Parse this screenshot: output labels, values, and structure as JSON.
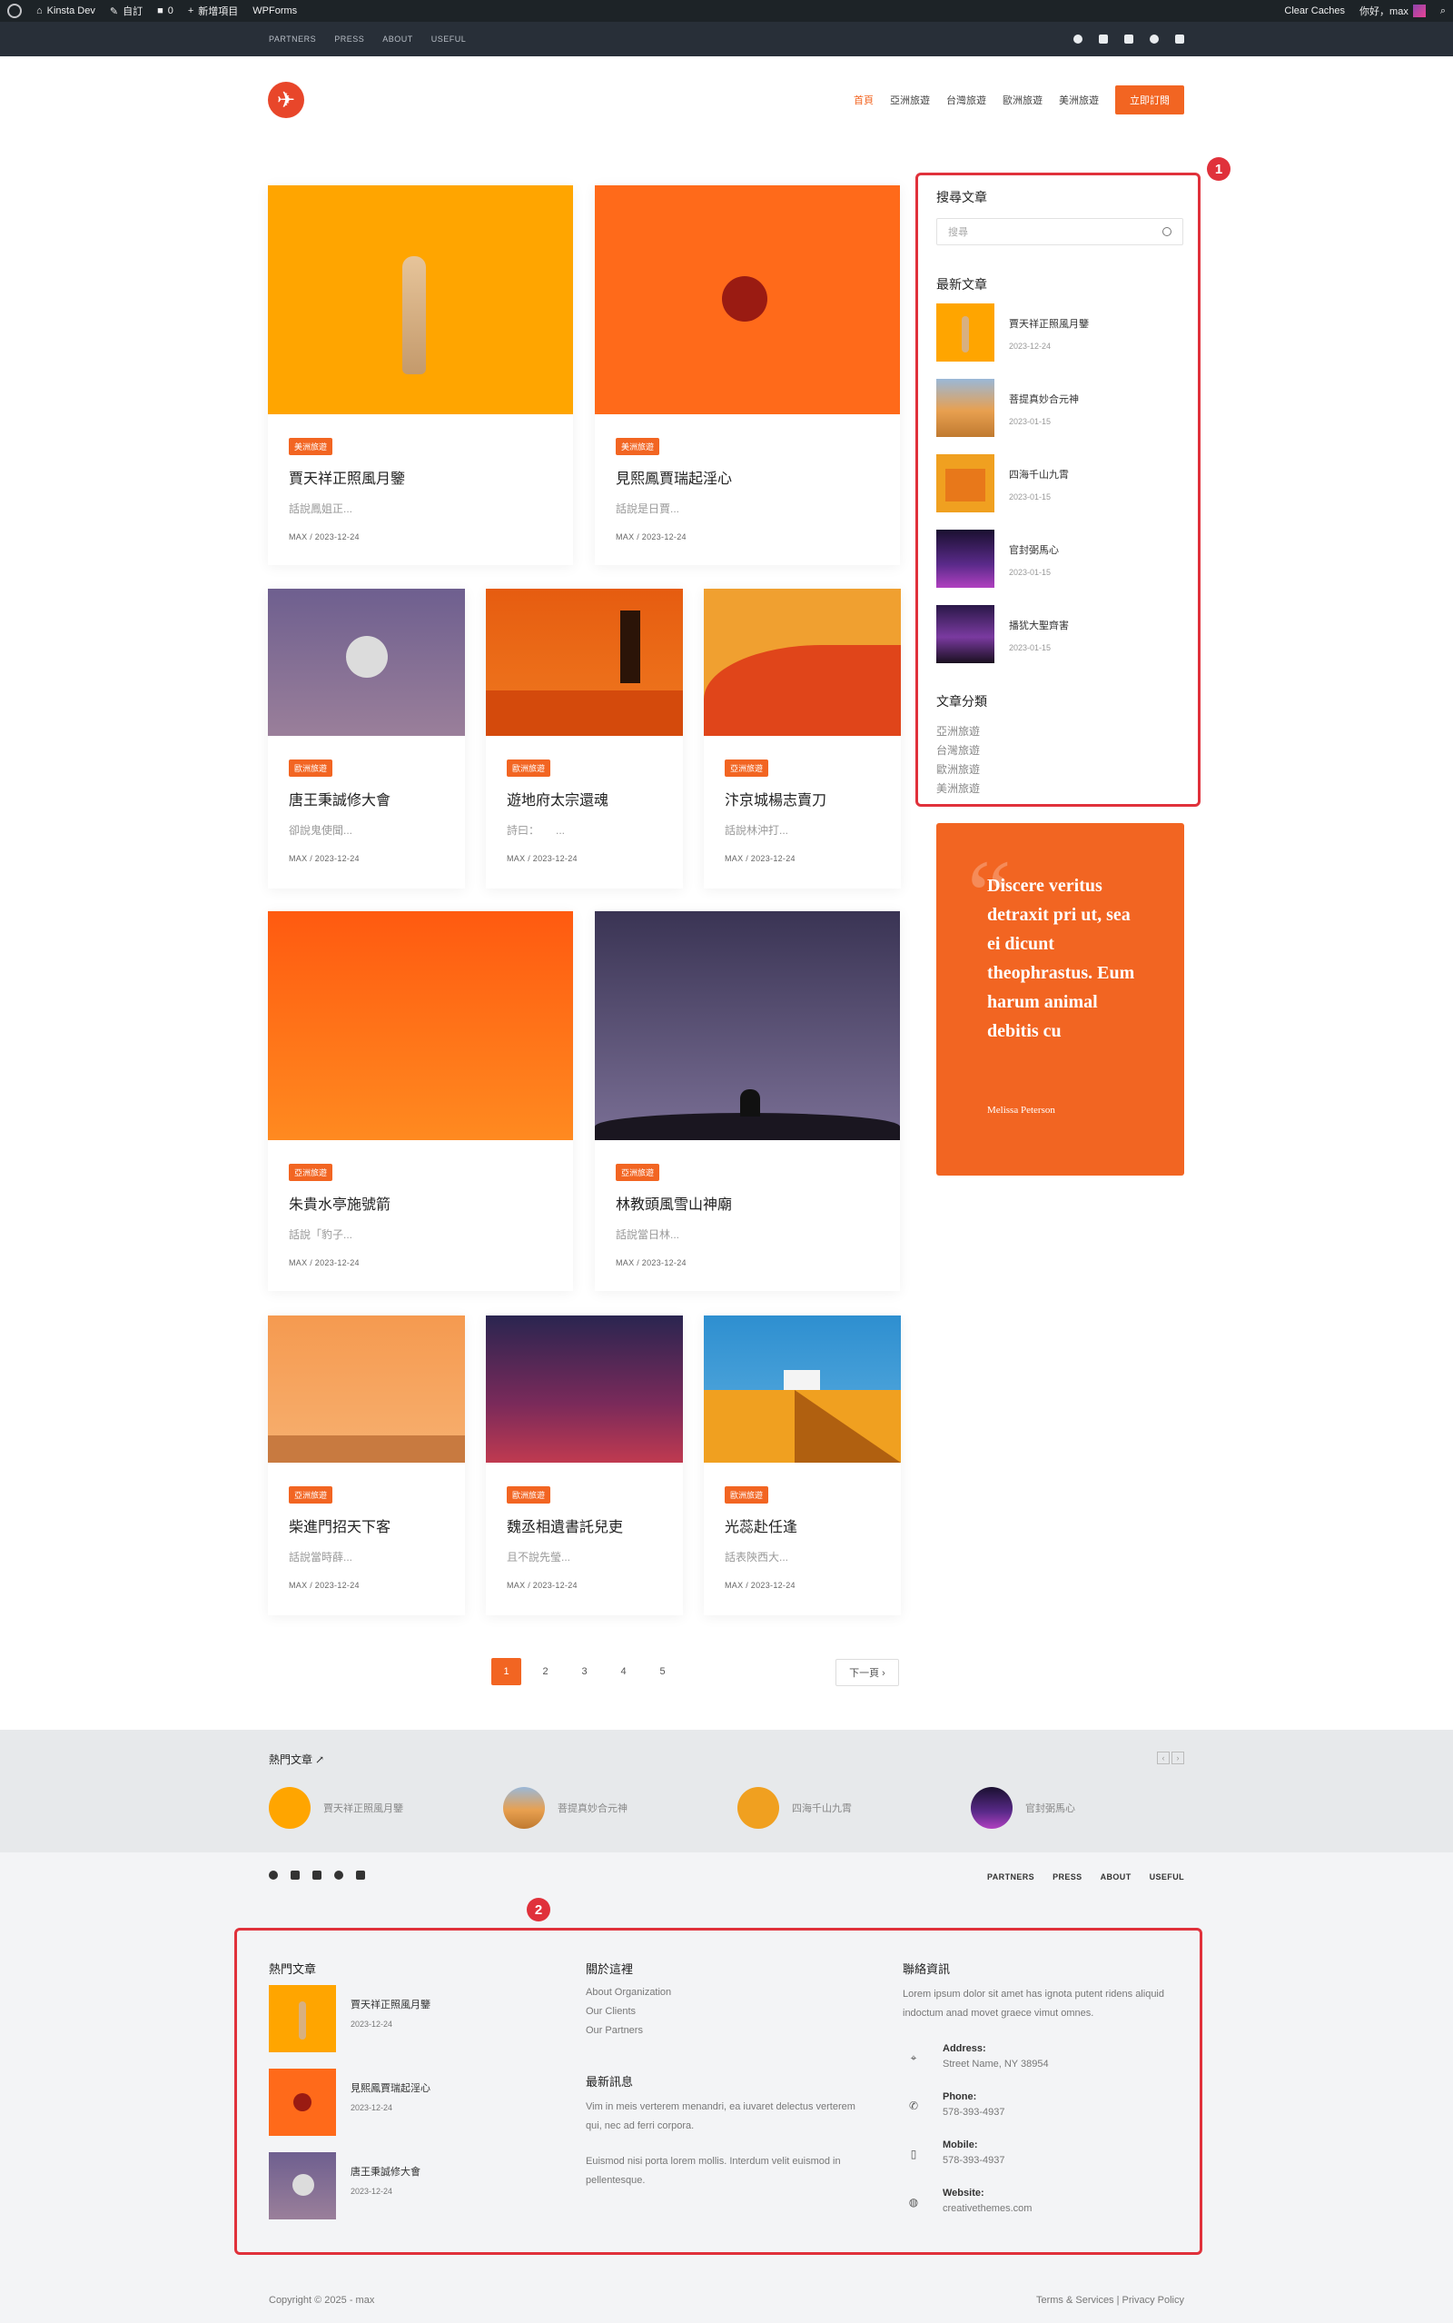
{
  "adminbar": {
    "site": "Kinsta Dev",
    "customize": "自訂",
    "comments": "0",
    "new": "新增項目",
    "wpforms": "WPForms",
    "clear_caches": "Clear Caches",
    "greeting": "你好，max"
  },
  "topbar": {
    "links": [
      "PARTNERS",
      "PRESS",
      "ABOUT",
      "USEFUL"
    ]
  },
  "nav": {
    "items": [
      "首頁",
      "亞洲旅遊",
      "台灣旅遊",
      "歐洲旅遊",
      "美洲旅遊"
    ],
    "cta": "立即訂閱"
  },
  "posts": [
    {
      "tag": "美洲旅遊",
      "title": "賈天祥正照風月鑒",
      "excerpt": "話說鳳姐正...",
      "meta": "MAX  /  2023-12-24"
    },
    {
      "tag": "美洲旅遊",
      "title": "見熙鳳賈瑞起淫心",
      "excerpt": "話說是日賈...",
      "meta": "MAX  /  2023-12-24"
    },
    {
      "tag": "歐洲旅遊",
      "title": "唐王秉誠修大會",
      "excerpt": "卻說鬼使聞...",
      "meta": "MAX  /  2023-12-24"
    },
    {
      "tag": "歐洲旅遊",
      "title": "遊地府太宗還魂",
      "excerpt": "詩曰：　　...",
      "meta": "MAX  /  2023-12-24"
    },
    {
      "tag": "亞洲旅遊",
      "title": "汴京城楊志賣刀",
      "excerpt": "話說林沖打...",
      "meta": "MAX  /  2023-12-24"
    },
    {
      "tag": "亞洲旅遊",
      "title": "朱貴水亭施號箭",
      "excerpt": "話說「豹子...",
      "meta": "MAX  /  2023-12-24"
    },
    {
      "tag": "亞洲旅遊",
      "title": "林教頭風雪山神廟",
      "excerpt": "話說當日林...",
      "meta": "MAX  /  2023-12-24"
    },
    {
      "tag": "亞洲旅遊",
      "title": "柴進門招天下客",
      "excerpt": "話說當時薛...",
      "meta": "MAX  /  2023-12-24"
    },
    {
      "tag": "歐洲旅遊",
      "title": "魏丞相遺書託兒吏",
      "excerpt": "且不說先瑩...",
      "meta": "MAX  /  2023-12-24"
    },
    {
      "tag": "歐洲旅遊",
      "title": "光蕊赴任逢",
      "excerpt": "話表陝西大...",
      "meta": "MAX  /  2023-12-24"
    }
  ],
  "sidebar": {
    "marker": "1",
    "search_title": "搜尋文章",
    "search_placeholder": "搜尋",
    "recent_title": "最新文章",
    "recent": [
      {
        "title": "賈天祥正照風月鑒",
        "date": "2023-12-24"
      },
      {
        "title": "菩提真妙合元神",
        "date": "2023-01-15"
      },
      {
        "title": "四海千山九霄",
        "date": "2023-01-15"
      },
      {
        "title": "官封弼馬心",
        "date": "2023-01-15"
      },
      {
        "title": "播犹大聖齊害",
        "date": "2023-01-15"
      }
    ],
    "cat_title": "文章分類",
    "categories": [
      "亞洲旅遊",
      "台灣旅遊",
      "歐洲旅遊",
      "美洲旅遊"
    ]
  },
  "quote": {
    "text": "Discere veritus detraxit pri ut, sea ei dicunt theophrastus. Eum harum animal debitis cu",
    "author": "Melissa Peterson"
  },
  "pagination": {
    "pages": [
      "1",
      "2",
      "3",
      "4",
      "5"
    ],
    "next": "下一頁 ›"
  },
  "popular_strip": {
    "title": "熱門文章",
    "items": [
      "賈天祥正照風月鑒",
      "菩提真妙合元神",
      "四海千山九霄",
      "官封弼馬心"
    ]
  },
  "footer": {
    "links": [
      "PARTNERS",
      "PRESS",
      "ABOUT",
      "USEFUL"
    ],
    "marker": "2",
    "popular_title": "熱門文章",
    "popular": [
      {
        "title": "賈天祥正照風月鑒",
        "date": "2023-12-24"
      },
      {
        "title": "見熙鳳賈瑞起淫心",
        "date": "2023-12-24"
      },
      {
        "title": "唐王秉誠修大會",
        "date": "2023-12-24"
      }
    ],
    "about_title": "關於這裡",
    "about_links": [
      "About Organization",
      "Our Clients",
      "Our Partners"
    ],
    "news_title": "最新訊息",
    "news_1": "Vim in meis verterem menandri, ea iuvaret delectus verterem qui, nec ad ferri corpora.",
    "news_2": "Euismod nisi porta lorem mollis. Interdum velit euismod in pellentesque.",
    "contact_title": "聯絡資訊",
    "contact_intro": "Lorem ipsum dolor sit amet has ignota putent ridens aliquid indoctum anad movet graece vimut omnes.",
    "contacts": [
      {
        "label": "Address:",
        "value": "Street Name, NY 38954"
      },
      {
        "label": "Phone:",
        "value": "578-393-4937"
      },
      {
        "label": "Mobile:",
        "value": "578-393-4937"
      },
      {
        "label": "Website:",
        "value": "creativethemes.com"
      }
    ],
    "copyright": "Copyright © 2025 - max",
    "terms": "Terms & Services | Privacy Policy"
  }
}
